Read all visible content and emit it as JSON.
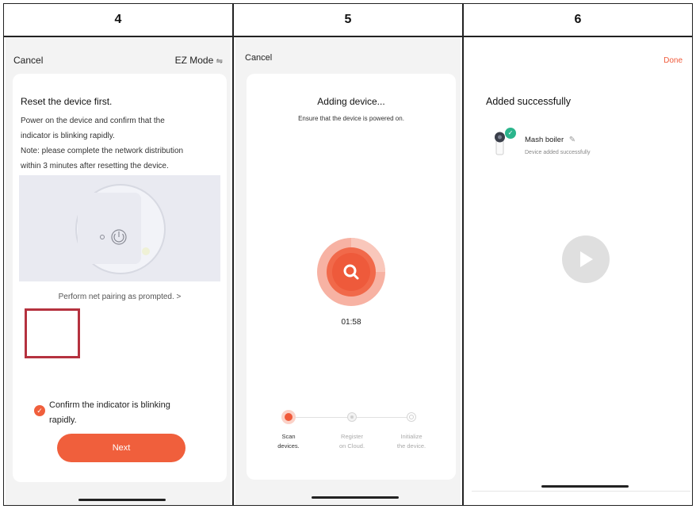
{
  "columns": [
    {
      "number": "4"
    },
    {
      "number": "5"
    },
    {
      "number": "6"
    }
  ],
  "screen4": {
    "cancel_label": "Cancel",
    "mode_label": "EZ Mode",
    "mode_icon": "swap-arrows-icon",
    "title": "Reset the device first.",
    "line1": "Power on the device and confirm that the",
    "line2": "indicator is blinking rapidly.",
    "line3": "Note: please complete the network distribution",
    "line4": "within 3 minutes after resetting the device.",
    "pairing_link": "Perform net pairing as prompted. >",
    "confirm_line1": "Confirm the indicator is blinking",
    "confirm_line2": "rapidly.",
    "confirm_checked": true,
    "next_label": "Next",
    "highlight_color": "#b5323f"
  },
  "screen5": {
    "cancel_label": "Cancel",
    "title": "Adding device...",
    "subtitle": "Ensure that the device is powered on.",
    "timer": "01:58",
    "steps": [
      {
        "line1": "Scan",
        "line2": "devices.",
        "state": "active"
      },
      {
        "line1": "Register",
        "line2": "on Cloud.",
        "state": "pending"
      },
      {
        "line1": "Initialize",
        "line2": "the device.",
        "state": "pending"
      }
    ],
    "accent": "#f05a3a"
  },
  "screen6": {
    "done_label": "Done",
    "title": "Added successfully",
    "device_name": "Mash boiler",
    "device_status": "Device added successfully",
    "success_color": "#2bb58c"
  }
}
